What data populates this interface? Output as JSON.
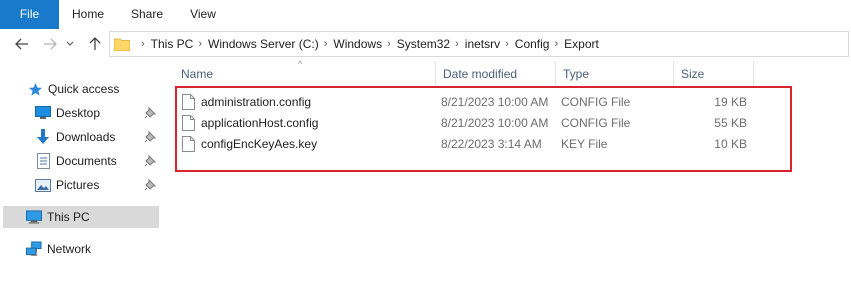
{
  "ribbon": {
    "tabs": [
      {
        "label": "File"
      },
      {
        "label": "Home"
      },
      {
        "label": "Share"
      },
      {
        "label": "View"
      }
    ]
  },
  "address_bar": {
    "crumbs": [
      "This PC",
      "Windows Server (C:)",
      "Windows",
      "System32",
      "inetsrv",
      "Config",
      "Export"
    ]
  },
  "nav_pane": {
    "items": [
      {
        "label": "Quick access",
        "icon": "star-icon"
      },
      {
        "label": "Desktop",
        "icon": "desktop-icon",
        "pinned": true
      },
      {
        "label": "Downloads",
        "icon": "download-arrow-icon",
        "pinned": true
      },
      {
        "label": "Documents",
        "icon": "documents-icon",
        "pinned": true
      },
      {
        "label": "Pictures",
        "icon": "pictures-icon",
        "pinned": true
      },
      {
        "label": "This PC",
        "icon": "computer-icon",
        "selected": true
      },
      {
        "label": "Network",
        "icon": "network-icon"
      }
    ]
  },
  "file_list": {
    "columns": [
      "Name",
      "Date modified",
      "Type",
      "Size"
    ],
    "rows": [
      {
        "name": "administration.config",
        "date": "8/21/2023 10:00 AM",
        "type": "CONFIG File",
        "size": "19 KB"
      },
      {
        "name": "applicationHost.config",
        "date": "8/21/2023 10:00 AM",
        "type": "CONFIG File",
        "size": "55 KB"
      },
      {
        "name": "configEncKeyAes.key",
        "date": "8/22/2023 3:14 AM",
        "type": "KEY File",
        "size": "10 KB"
      }
    ]
  },
  "colors": {
    "file_tab": "#1979ca",
    "highlight_border": "#d9232e",
    "selection": "#d9d9d9"
  }
}
